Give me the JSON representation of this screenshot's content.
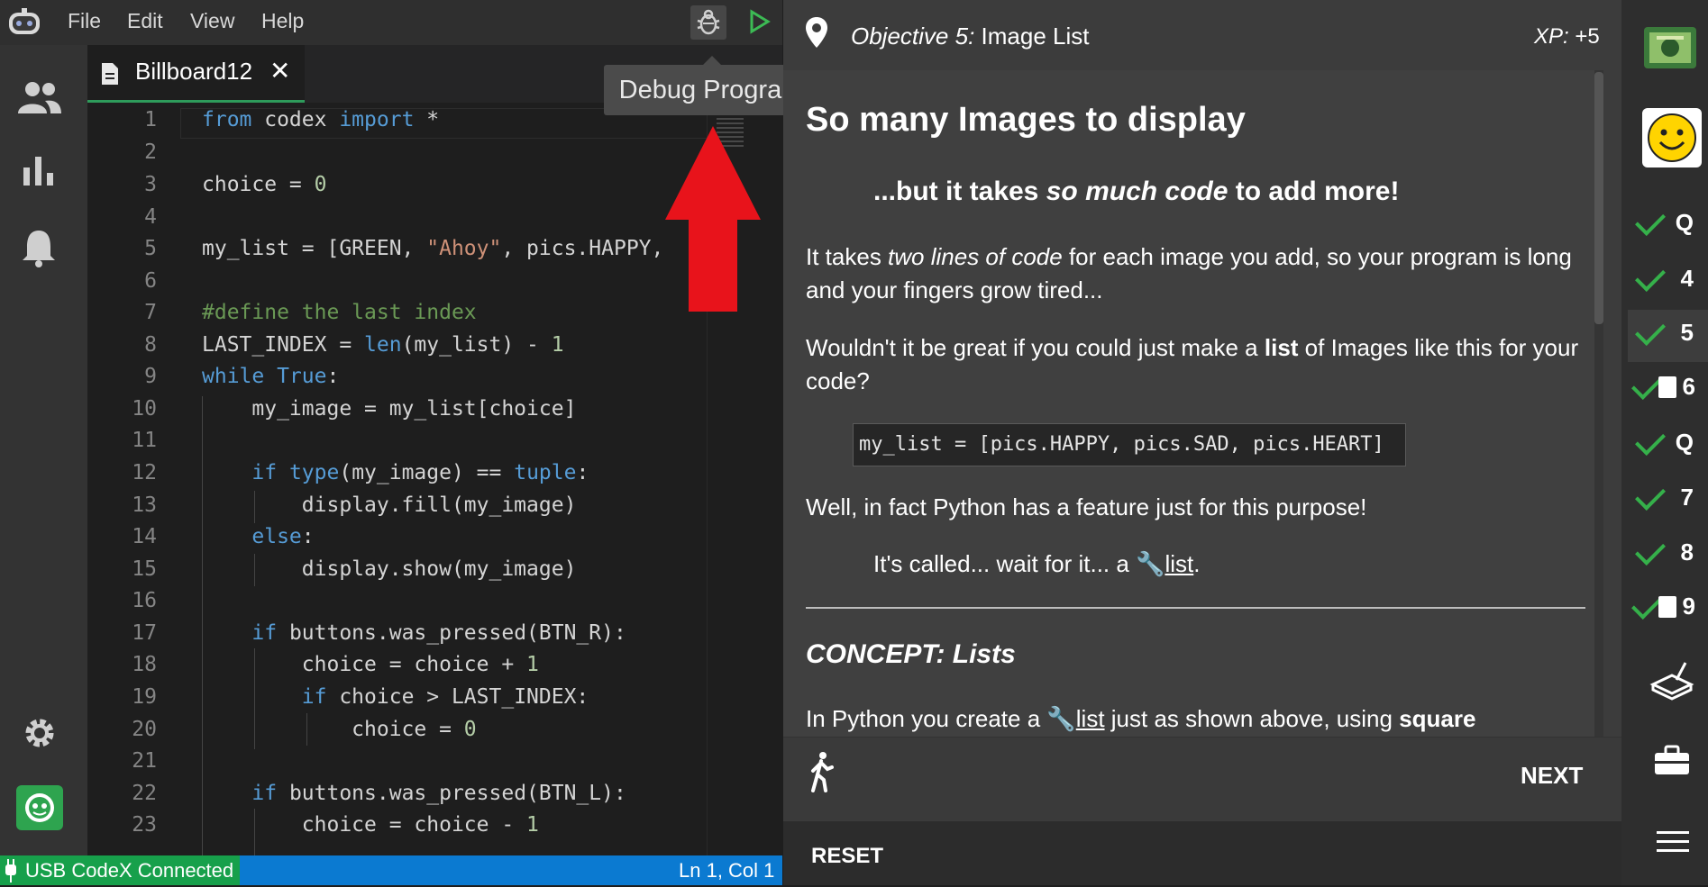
{
  "menu": {
    "items": [
      "File",
      "Edit",
      "View",
      "Help"
    ],
    "debug_tooltip": "Debug Program"
  },
  "editor": {
    "tab_label": "Billboard12",
    "line_numbers": [
      "1",
      "2",
      "3",
      "4",
      "5",
      "6",
      "7",
      "8",
      "9",
      "10",
      "11",
      "12",
      "13",
      "14",
      "15",
      "16",
      "17",
      "18",
      "19",
      "20",
      "21",
      "22",
      "23"
    ]
  },
  "status": {
    "connection": "USB CodeX Connected",
    "cursor": "Ln 1, Col 1"
  },
  "lesson": {
    "objective_prefix": "Objective 5:",
    "objective_title": "Image List",
    "xp_label": "XP:",
    "xp_value": "+5",
    "heading": "So many Images to display",
    "subheading_pre": "...but it takes ",
    "subheading_em": "so much code",
    "subheading_post": " to add more!",
    "p1_pre": "It takes ",
    "p1_em": "two lines of code",
    "p1_post": " for each image you add, so your program is long and your fingers grow tired...",
    "p2_pre": "Wouldn't it be great if you could just make a ",
    "p2_bold": "list",
    "p2_post": " of Images like this for your code?",
    "code_sample": "my_list = [pics.HAPPY, pics.SAD, pics.HEART]",
    "p3": "Well, in fact Python has a feature just for this purpose!",
    "p4_pre": "It's called... wait for it... a ",
    "p4_link": "list",
    "p4_post": ".",
    "concept_title": "CONCEPT: Lists",
    "p5_pre": "In Python you create a ",
    "p5_link": "list",
    "p5_mid": " just as shown above, using ",
    "p5_bold": "square",
    "next_label": "NEXT",
    "reset_label": "RESET"
  },
  "objectives": [
    {
      "label": "Q",
      "done": true
    },
    {
      "label": "4",
      "done": true
    },
    {
      "label": "5",
      "done": true
    },
    {
      "label": "6",
      "done": true
    },
    {
      "label": "Q",
      "done": true
    },
    {
      "label": "7",
      "done": true
    },
    {
      "label": "8",
      "done": true
    },
    {
      "label": "9",
      "done": true
    }
  ]
}
